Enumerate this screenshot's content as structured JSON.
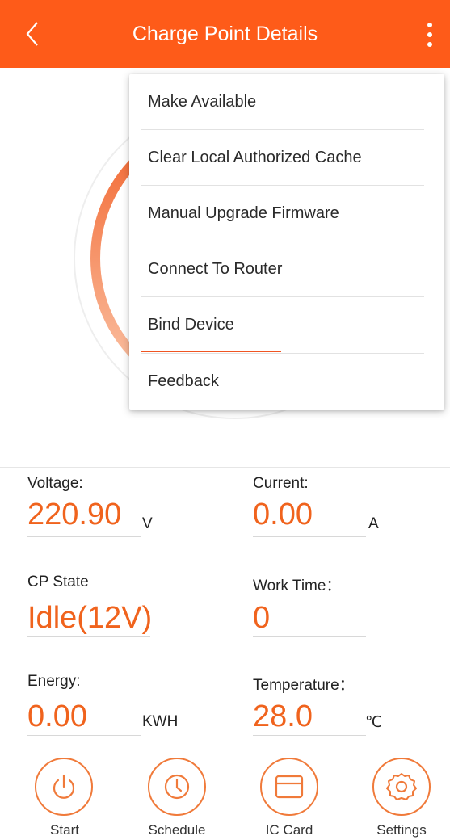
{
  "header": {
    "title": "Charge Point Details",
    "back_icon": "chevron-left-icon",
    "more_icon": "more-vertical-icon"
  },
  "menu": {
    "items": [
      {
        "label": "Make Available"
      },
      {
        "label": "Clear Local Authorized Cache"
      },
      {
        "label": "Manual Upgrade Firmware"
      },
      {
        "label": "Connect To Router"
      },
      {
        "label": "Bind Device"
      },
      {
        "label": "Feedback"
      }
    ],
    "focused_item": "Bind Device"
  },
  "readings": {
    "voltage": {
      "label": "Voltage:",
      "value": "220.90",
      "unit": "V"
    },
    "current": {
      "label": "Current:",
      "value": "0.00",
      "unit": "A"
    },
    "cp_state": {
      "label": "CP State",
      "value": "Idle(12V)"
    },
    "work_time": {
      "label": "Work Time：",
      "value": "0"
    },
    "energy": {
      "label": "Energy:",
      "value": "0.00",
      "unit": "KWH"
    },
    "temperature": {
      "label": "Temperature：",
      "value": "28.0",
      "unit": "℃"
    }
  },
  "nav": {
    "start": {
      "label": "Start",
      "icon": "power-icon"
    },
    "schedule": {
      "label": "Schedule",
      "icon": "clock-icon"
    },
    "ic_card": {
      "label": "IC Card",
      "icon": "card-icon"
    },
    "settings": {
      "label": "Settings",
      "icon": "gear-icon"
    }
  },
  "colors": {
    "accent": "#fe5b19",
    "value": "#f0631d"
  }
}
